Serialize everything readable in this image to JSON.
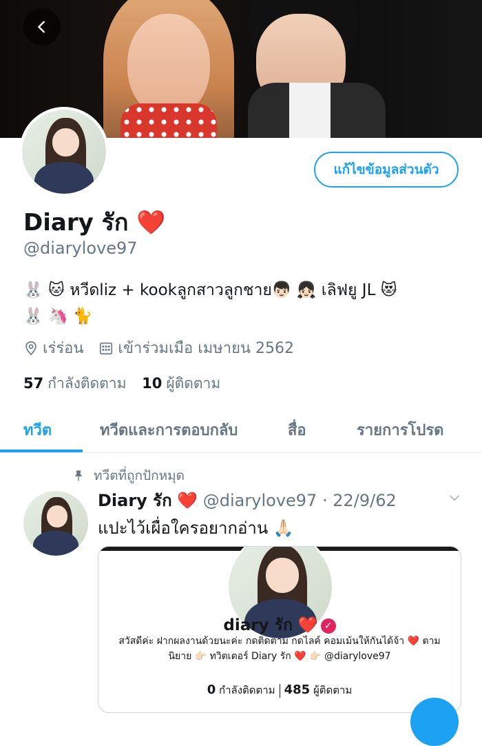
{
  "banner": {
    "alt": ""
  },
  "profile": {
    "edit_label": "แก้ไขข้อมูลส่วนตัว",
    "name": "Diary รัก",
    "name_emoji": "❤️",
    "handle": "@diarylove97",
    "bio_line1": "🐰 🐱 หวีดliz + kookลูกสาวลูกชาย👦🏻 👧🏻 เลิฟยู JL 😻",
    "bio_line2": "🐰 🦄 🐈",
    "location": "เร่ร่อน",
    "joined": "เข้าร่วมเมือ เมษายน 2562",
    "following_count": "57",
    "following_label": "กำลังติดตาม",
    "followers_count": "10",
    "followers_label": "ผู้ติดตาม"
  },
  "tabs": [
    "ทวีต",
    "ทวีตและการตอบกลับ",
    "สื่อ",
    "รายการโปรด"
  ],
  "pinned": {
    "label": "ทวีตที่ถูกปักหมุด"
  },
  "tweet": {
    "name": "Diary รัก",
    "emoji": "❤️",
    "handle_date": "@diarylove97 · 22/9/62",
    "text": "แปะไว้เผื่อใครอยากอ่าน 🙏🏻"
  },
  "card": {
    "name": "diary รัก ❤️",
    "verified": "✓",
    "bio": "สวัสดีค่ะ ฝากผลงานด้วยนะค่ะ กดติดตาม กดไลค์ คอมเม้นให้กันได้จ้า ❤️ ตามนิยาย 👉🏻 ทวิตเตอร์ Diary รัก ❤️ 👉🏻 @diarylove97",
    "following_count": "0",
    "following_label": "กำลังติดตาม",
    "followers_count": "485",
    "followers_label": "ผู้ติดตาม"
  },
  "icons": {
    "back": "chevron-left-icon",
    "location": "location-pin-icon",
    "calendar": "calendar-icon",
    "pin": "pin-icon",
    "caret": "chevron-down-icon"
  },
  "colors": {
    "accent": "#1da1f2",
    "muted": "#657786",
    "heart": "#e0245e"
  }
}
